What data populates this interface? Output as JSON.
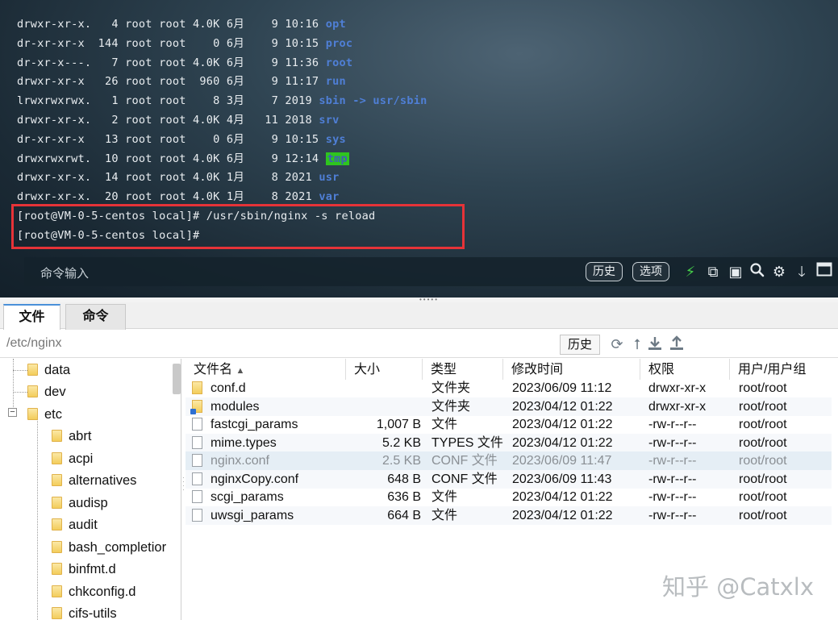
{
  "terminal": {
    "lines": [
      {
        "meta": "drwxr-xr-x.   4 root root 4.0K 6月    9 10:16 ",
        "name": "opt",
        "suffix": ""
      },
      {
        "meta": "dr-xr-xr-x  144 root root    0 6月    9 10:15 ",
        "name": "proc",
        "suffix": ""
      },
      {
        "meta": "dr-xr-x---.   7 root root 4.0K 6月    9 11:36 ",
        "name": "root",
        "suffix": ""
      },
      {
        "meta": "drwxr-xr-x   26 root root  960 6月    9 11:17 ",
        "name": "run",
        "suffix": ""
      },
      {
        "meta": "lrwxrwxrwx.   1 root root    8 3月    7 2019 ",
        "name": "sbin",
        "suffix": " -> usr/sbin"
      },
      {
        "meta": "drwxr-xr-x.   2 root root 4.0K 4月   11 2018 ",
        "name": "srv",
        "suffix": ""
      },
      {
        "meta": "dr-xr-xr-x   13 root root    0 6月    9 10:15 ",
        "name": "sys",
        "suffix": ""
      },
      {
        "meta": "drwxrwxrwt.  10 root root 4.0K 6月    9 12:14 ",
        "name": "tmp",
        "suffix": ""
      },
      {
        "meta": "drwxr-xr-x.  14 root root 4.0K 1月    8 2021 ",
        "name": "usr",
        "suffix": ""
      },
      {
        "meta": "drwxr-xr-x.  20 root root 4.0K 1月    8 2021 ",
        "name": "var",
        "suffix": ""
      }
    ],
    "prompt_lines": [
      "[root@VM-0-5-centos local]# /usr/sbin/nginx -s reload",
      "[root@VM-0-5-centos local]#"
    ],
    "command_placeholder": "命令输入",
    "history_label": "历史",
    "options_label": "选项"
  },
  "tabs": [
    {
      "label": "文件",
      "active": true
    },
    {
      "label": "命令",
      "active": false
    }
  ],
  "path_bar": {
    "path": "/etc/nginx",
    "history_label": "历史"
  },
  "tree": {
    "items": [
      {
        "label": "data",
        "level": 0
      },
      {
        "label": "dev",
        "level": 0
      },
      {
        "label": "etc",
        "level": 0,
        "expanded": true
      },
      {
        "label": "abrt",
        "level": 1
      },
      {
        "label": "acpi",
        "level": 1
      },
      {
        "label": "alternatives",
        "level": 1
      },
      {
        "label": "audisp",
        "level": 1
      },
      {
        "label": "audit",
        "level": 1
      },
      {
        "label": "bash_completior",
        "level": 1
      },
      {
        "label": "binfmt.d",
        "level": 1
      },
      {
        "label": "chkconfig.d",
        "level": 1
      },
      {
        "label": "cifs-utils",
        "level": 1
      }
    ]
  },
  "file_list": {
    "columns": [
      "文件名",
      "大小",
      "类型",
      "修改时间",
      "权限",
      "用户/用户组"
    ],
    "sort_indicator": "▲",
    "rows": [
      {
        "icon": "folder",
        "name": "conf.d",
        "size": "",
        "type": "文件夹",
        "mtime": "2023/06/09 11:12",
        "perm": "drwxr-xr-x",
        "owner": "root/root"
      },
      {
        "icon": "link",
        "name": "modules",
        "size": "",
        "type": "文件夹",
        "mtime": "2023/04/12 01:22",
        "perm": "drwxr-xr-x",
        "owner": "root/root"
      },
      {
        "icon": "file",
        "name": "fastcgi_params",
        "size": "1,007 B",
        "type": "文件",
        "mtime": "2023/04/12 01:22",
        "perm": "-rw-r--r--",
        "owner": "root/root"
      },
      {
        "icon": "file",
        "name": "mime.types",
        "size": "5.2 KB",
        "type": "TYPES 文件",
        "mtime": "2023/04/12 01:22",
        "perm": "-rw-r--r--",
        "owner": "root/root"
      },
      {
        "icon": "file",
        "name": "nginx.conf",
        "size": "2.5 KB",
        "type": "CONF 文件",
        "mtime": "2023/06/09 11:47",
        "perm": "-rw-r--r--",
        "owner": "root/root",
        "selected": true
      },
      {
        "icon": "file",
        "name": "nginxCopy.conf",
        "size": "648 B",
        "type": "CONF 文件",
        "mtime": "2023/06/09 11:43",
        "perm": "-rw-r--r--",
        "owner": "root/root"
      },
      {
        "icon": "file",
        "name": "scgi_params",
        "size": "636 B",
        "type": "文件",
        "mtime": "2023/04/12 01:22",
        "perm": "-rw-r--r--",
        "owner": "root/root"
      },
      {
        "icon": "file",
        "name": "uwsgi_params",
        "size": "664 B",
        "type": "文件",
        "mtime": "2023/04/12 01:22",
        "perm": "-rw-r--r--",
        "owner": "root/root"
      }
    ]
  },
  "watermark": "知乎 @Catxlx",
  "colors": {
    "terminal_dir": "#4f7fd6",
    "tmp_highlight": "#2ec51e",
    "annotation_box": "#e63338",
    "selected_row": "#e5eef5"
  }
}
